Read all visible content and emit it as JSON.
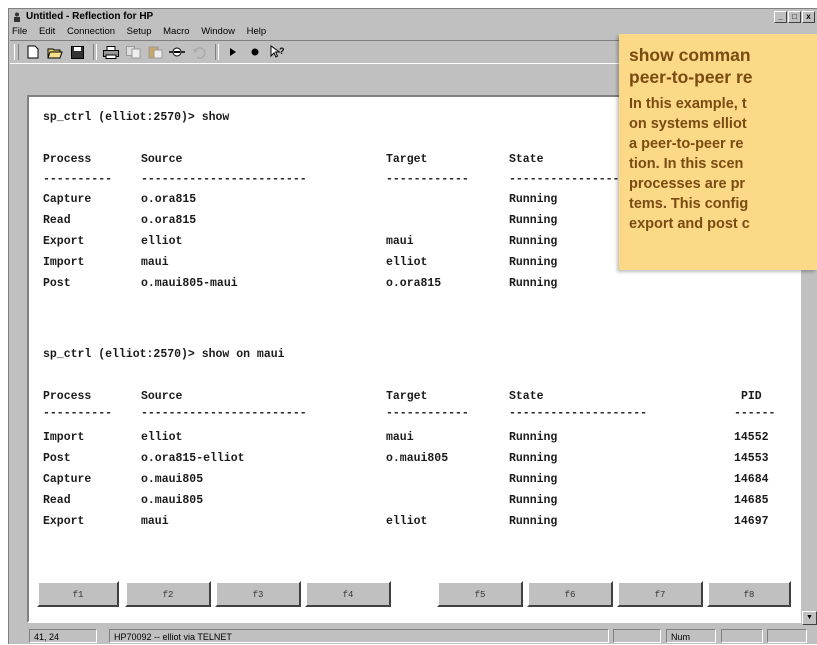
{
  "window": {
    "title": "Untitled - Reflection for HP",
    "controls": [
      "_",
      "□",
      "x"
    ]
  },
  "menu": [
    "File",
    "Edit",
    "Connection",
    "Setup",
    "Macro",
    "Window",
    "Help"
  ],
  "toolbar_icons": [
    "new-icon",
    "open-icon",
    "save-icon",
    "print-icon",
    "copy-icon",
    "paste-icon",
    "connect-icon",
    "undo-icon",
    "play-icon",
    "record-icon",
    "help-pointer-icon"
  ],
  "terminal": {
    "block1": {
      "prompt": "sp_ctrl (elliot:2570)> show",
      "headers": [
        "Process",
        "Source",
        "Target",
        "State"
      ],
      "dashes": [
        "----------",
        "------------------------",
        "------------",
        "--------------------"
      ],
      "rows": [
        [
          "Capture",
          "o.ora815",
          "",
          "Running"
        ],
        [
          "Read",
          "o.ora815",
          "",
          "Running"
        ],
        [
          "Export",
          "elliot",
          "maui",
          "Running"
        ],
        [
          "Import",
          "maui",
          "elliot",
          "Running"
        ],
        [
          "Post",
          "o.maui805-maui",
          "o.ora815",
          "Running"
        ]
      ]
    },
    "block2": {
      "prompt": "sp_ctrl (elliot:2570)> show on maui",
      "headers": [
        "Process",
        "Source",
        "Target",
        "State",
        "PID"
      ],
      "dashes": [
        "----------",
        "------------------------",
        "------------",
        "--------------------",
        "------"
      ],
      "rows": [
        [
          "Import",
          "elliot",
          "maui",
          "Running",
          "14552"
        ],
        [
          "Post",
          "o.ora815-elliot",
          "o.maui805",
          "Running",
          "14553"
        ],
        [
          "Capture",
          "o.maui805",
          "",
          "Running",
          "14684"
        ],
        [
          "Read",
          "o.maui805",
          "",
          "Running",
          "14685"
        ],
        [
          "Export",
          "maui",
          "elliot",
          "Running",
          "14697"
        ]
      ]
    }
  },
  "function_keys": [
    "f1",
    "f2",
    "f3",
    "f4",
    "f5",
    "f6",
    "f7",
    "f8"
  ],
  "status": {
    "cursor": "41, 24",
    "connection": "HP70092 -- elliot via TELNET",
    "num": "Num"
  },
  "callout": {
    "title_line1": "show comman",
    "title_line2": "peer-to-peer re",
    "body_lines": [
      "In this example, t",
      "on systems elliot",
      "a peer-to-peer re",
      "tion. In this scen",
      "processes are pr",
      "tems. This config",
      "export and post c"
    ]
  },
  "colors": {
    "callout_bg": "#fbd987",
    "callout_text": "#7a4b12",
    "window_chrome": "#c0c0c0"
  }
}
